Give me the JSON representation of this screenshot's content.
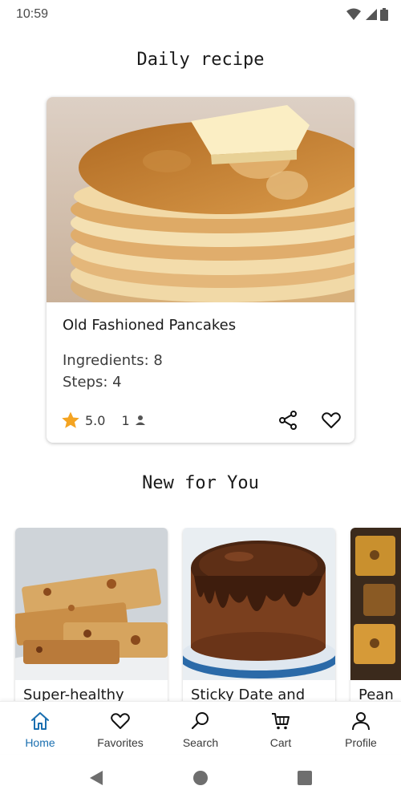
{
  "status": {
    "time": "10:59"
  },
  "sections": {
    "daily_title": "Daily recipe",
    "new_title": "New for You"
  },
  "daily": {
    "name": "Old Fashioned Pancakes",
    "ingredients": "Ingredients: 8",
    "steps": "Steps: 4",
    "rating": "5.0",
    "servings": "1"
  },
  "new_for_you": [
    {
      "title": "Super-healthy"
    },
    {
      "title": "Sticky Date and"
    },
    {
      "title": "Pean"
    }
  ],
  "nav": [
    {
      "label": "Home",
      "icon": "home-icon",
      "active": true
    },
    {
      "label": "Favorites",
      "icon": "heart-icon"
    },
    {
      "label": "Search",
      "icon": "search-icon"
    },
    {
      "label": "Cart",
      "icon": "cart-icon"
    },
    {
      "label": "Profile",
      "icon": "profile-icon"
    }
  ],
  "colors": {
    "accent": "#1a6fb0",
    "star": "#f4a422"
  }
}
